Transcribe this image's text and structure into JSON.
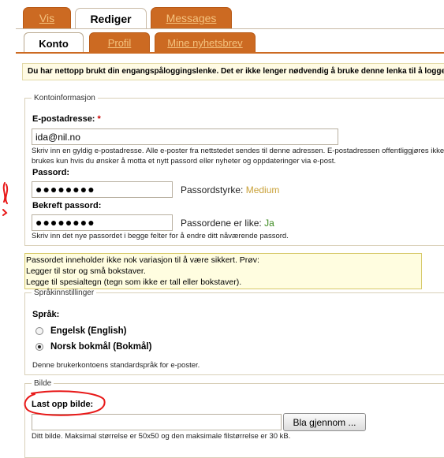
{
  "primary_tabs": [
    {
      "label": "Vis",
      "active": false
    },
    {
      "label": "Rediger",
      "active": true
    },
    {
      "label": "Messages",
      "active": false
    }
  ],
  "secondary_tabs": [
    {
      "label": "Konto",
      "active": true
    },
    {
      "label": "Profil",
      "active": false
    },
    {
      "label": "Mine nyhetsbrev",
      "active": false
    }
  ],
  "message": "Du har nettopp brukt din engangspåloggingslenke. Det er ikke lenger nødvendig å bruke denne lenka til å logge inn",
  "account": {
    "legend": "Kontoinformasjon",
    "email_label": "E-postadresse:",
    "required_marker": "*",
    "email_value": "ida@nil.no",
    "email_desc_line1": "Skriv inn en gyldig e-postadresse. Alle e-poster fra nettstedet sendes til denne adressen. E-postadressen offentliggjøres ikke og",
    "email_desc_line2": "brukes kun hvis du ønsker å motta et nytt passord eller nyheter og oppdateringer via e-post.",
    "password_label": "Passord:",
    "password_value": "●●●●●●●●",
    "strength_label": "Passordstyrke:",
    "strength_value": "Medium",
    "confirm_label": "Bekreft passord:",
    "confirm_value": "●●●●●●●●",
    "match_label": "Passordene er like:",
    "match_value": "Ja",
    "password_desc": "Skriv inn det nye passordet i begge felter for å endre ditt nåværende passord."
  },
  "password_warning": {
    "line1": "Passordet inneholder ikke nok variasjon til å være sikkert. Prøv:",
    "line2": "Legger til stor og små bokstaver.",
    "line3": "Legge til spesialtegn (tegn som ikke er tall eller bokstaver)."
  },
  "language": {
    "legend": "Språkinnstillinger",
    "label": "Språk:",
    "options": [
      {
        "label": "Engelsk (English)",
        "checked": false
      },
      {
        "label": "Norsk bokmål (Bokmål)",
        "checked": true
      }
    ],
    "desc": "Denne brukerkontoens standardspråk for e-poster."
  },
  "picture": {
    "legend": "Bilde",
    "upload_label": "Last opp bilde:",
    "file_value": "",
    "browse_label": "Bla gjennom ...",
    "desc": "Ditt bilde. Maksimal størrelse er 50x50 og den maksimale filstørrelse er 30 kB."
  },
  "colors": {
    "tab_orange": "#cc6a22",
    "tab_text": "#f4c27e",
    "annotation_red": "#e81919"
  }
}
